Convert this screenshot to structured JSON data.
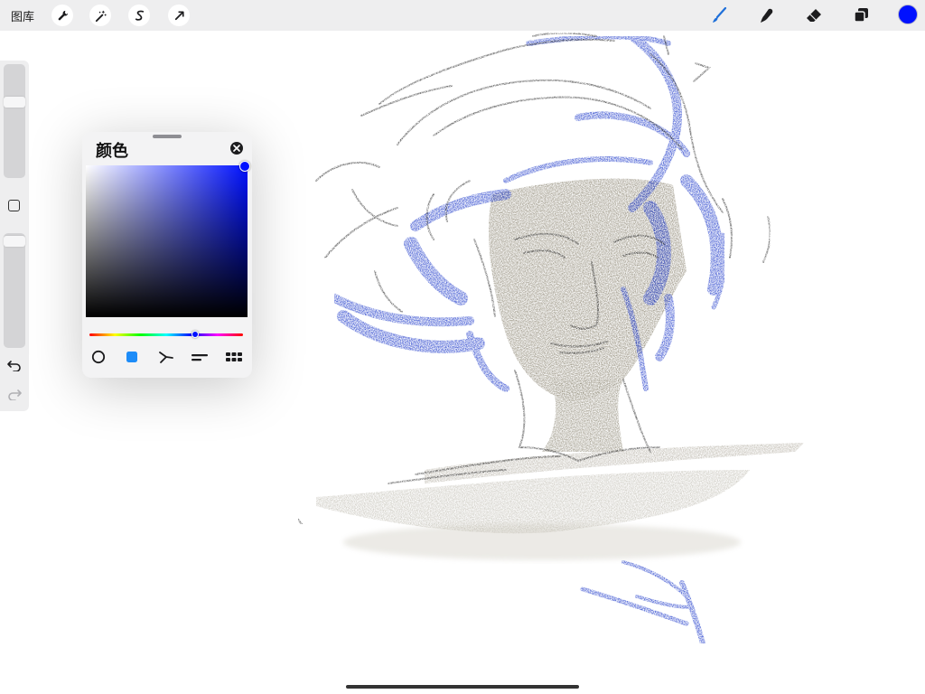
{
  "toolbar": {
    "gallery_label": "图库",
    "left_tools": [
      "wrench-icon",
      "magic-wand-icon",
      "selection-icon",
      "transform-arrow-icon"
    ],
    "right_tools": [
      "brush-icon",
      "smudge-icon",
      "eraser-icon",
      "layers-icon"
    ],
    "current_color": "#0011ff",
    "active_tool_color": "#1e6fd9"
  },
  "sidebar": {
    "brush_size_level": 0.32,
    "opacity_level": 0.03,
    "controls": [
      "modify-button",
      "undo-icon",
      "redo-icon"
    ]
  },
  "color_panel": {
    "title": "颜色",
    "selected_hue": "#0011ff",
    "hue_position": 0.69,
    "modes": [
      "disc-icon",
      "classic-icon",
      "harmony-icon",
      "value-icon",
      "palettes-icon"
    ],
    "active_mode": "classic-icon",
    "active_mode_color": "#1d8cf8"
  },
  "artwork": {
    "ink_color": "#2a2a2a",
    "blue_color": "#1733c8",
    "shadow_color": "#7d7560"
  }
}
